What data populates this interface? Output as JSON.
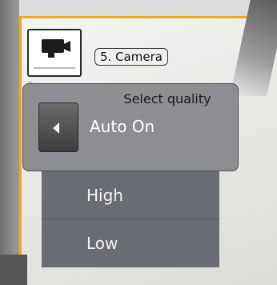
{
  "camera": {
    "label": "5. Camera"
  },
  "quality_menu": {
    "title": "Select quality",
    "current_value": "Auto On",
    "options": [
      "High",
      "Low"
    ]
  },
  "icons": {
    "camera": "video-camera-icon",
    "previous": "triangle-left-icon",
    "close": "close-icon"
  },
  "colors": {
    "accent_border": "#f2a81e",
    "panel_bg": "#787a80",
    "options_bg": "#6a6c73"
  }
}
